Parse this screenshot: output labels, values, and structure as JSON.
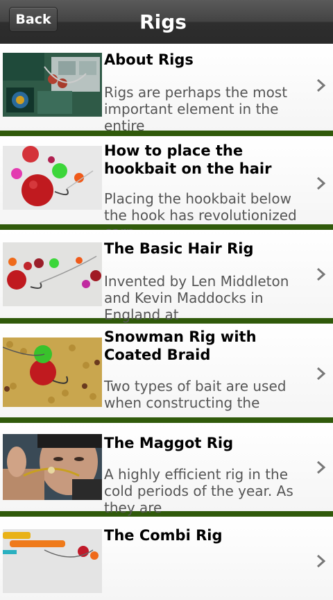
{
  "header": {
    "back_label": "Back",
    "title": "Rigs"
  },
  "items": [
    {
      "title": "About Rigs",
      "description": "Rigs are perhaps the most important element in the entire",
      "thumb": "tackle-box-image"
    },
    {
      "title": "How to place the hookbait on the hair",
      "description": "Placing the hookbait below the hook has revolutionized carp",
      "thumb": "boilie-hook-image"
    },
    {
      "title": "The Basic Hair Rig",
      "description": "Invented by Len Middleton and Kevin Maddocks in England at",
      "thumb": "hair-rig-image"
    },
    {
      "title": "Snowman Rig with Coated Braid",
      "description": "Two types of bait are used when constructing the",
      "thumb": "snowman-rig-image"
    },
    {
      "title": "The Maggot Rig",
      "description": "A highly efficient rig in the cold periods of the year. As they are",
      "thumb": "maggot-rig-image"
    },
    {
      "title": "The Combi Rig",
      "description": "",
      "thumb": "combi-rig-image"
    }
  ],
  "colors": {
    "separator": "#305a0b",
    "header": "#3a3a3a"
  }
}
